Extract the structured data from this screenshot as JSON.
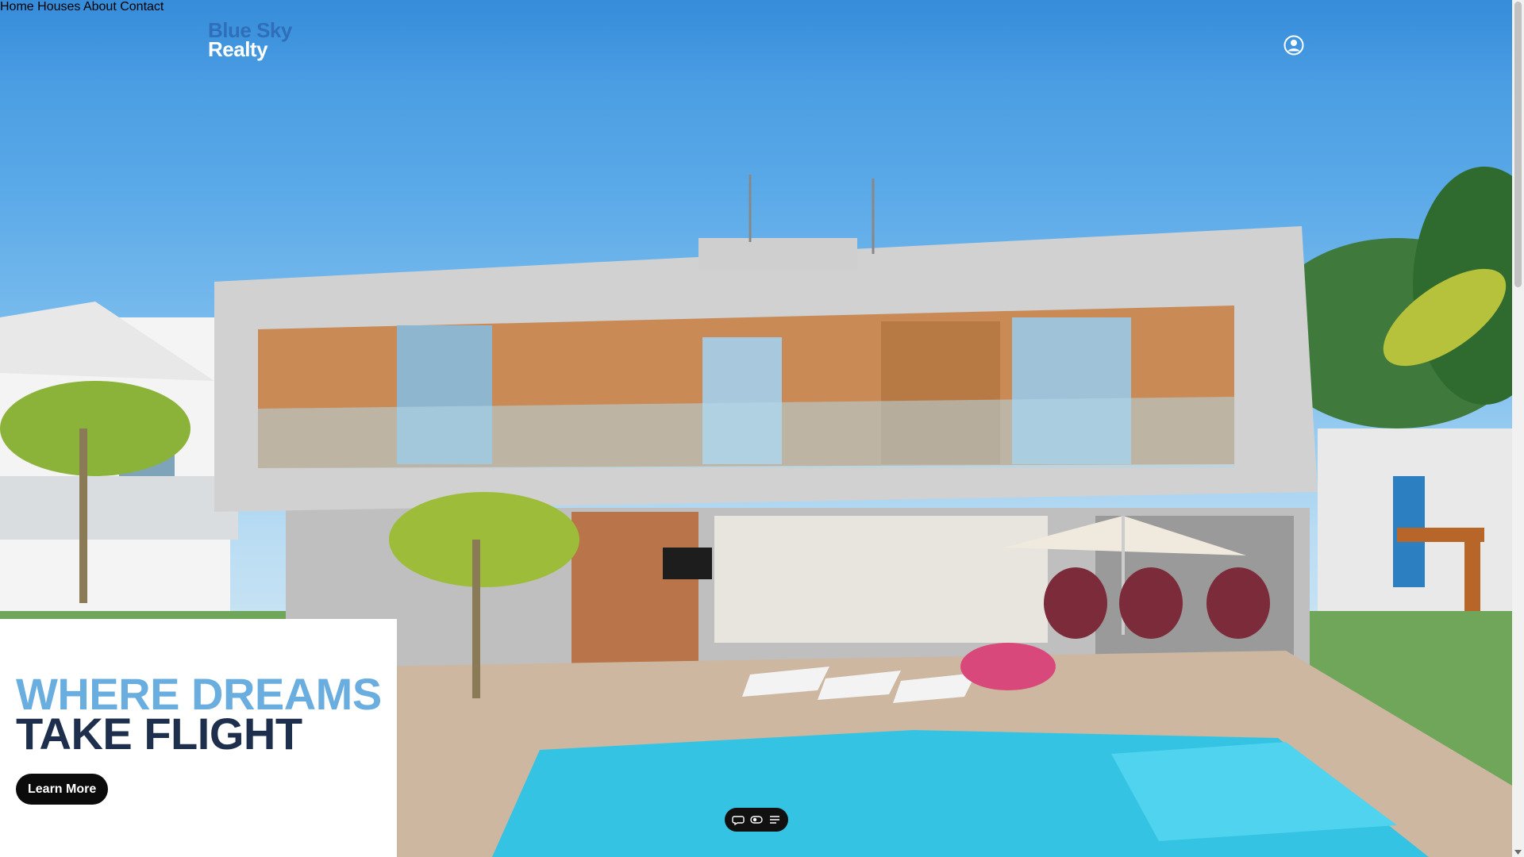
{
  "brand": {
    "line1": "Blue Sky",
    "line2": "Realty"
  },
  "nav": {
    "items": [
      "Home",
      "Houses",
      "About",
      "Contact"
    ]
  },
  "hero": {
    "headline_line1": "WHERE DREAMS",
    "headline_line2": "TAKE FLIGHT",
    "cta_label": "Learn More"
  },
  "colors": {
    "brand_blue": "#2f6fb9",
    "headline_light": "#6aaee0",
    "headline_dark": "#1d2f4c",
    "button_bg": "#0b0b0b"
  },
  "icons": {
    "account": "user-circle-icon",
    "toolbar": [
      "chat-icon",
      "toggle-icon",
      "menu-icon"
    ]
  }
}
